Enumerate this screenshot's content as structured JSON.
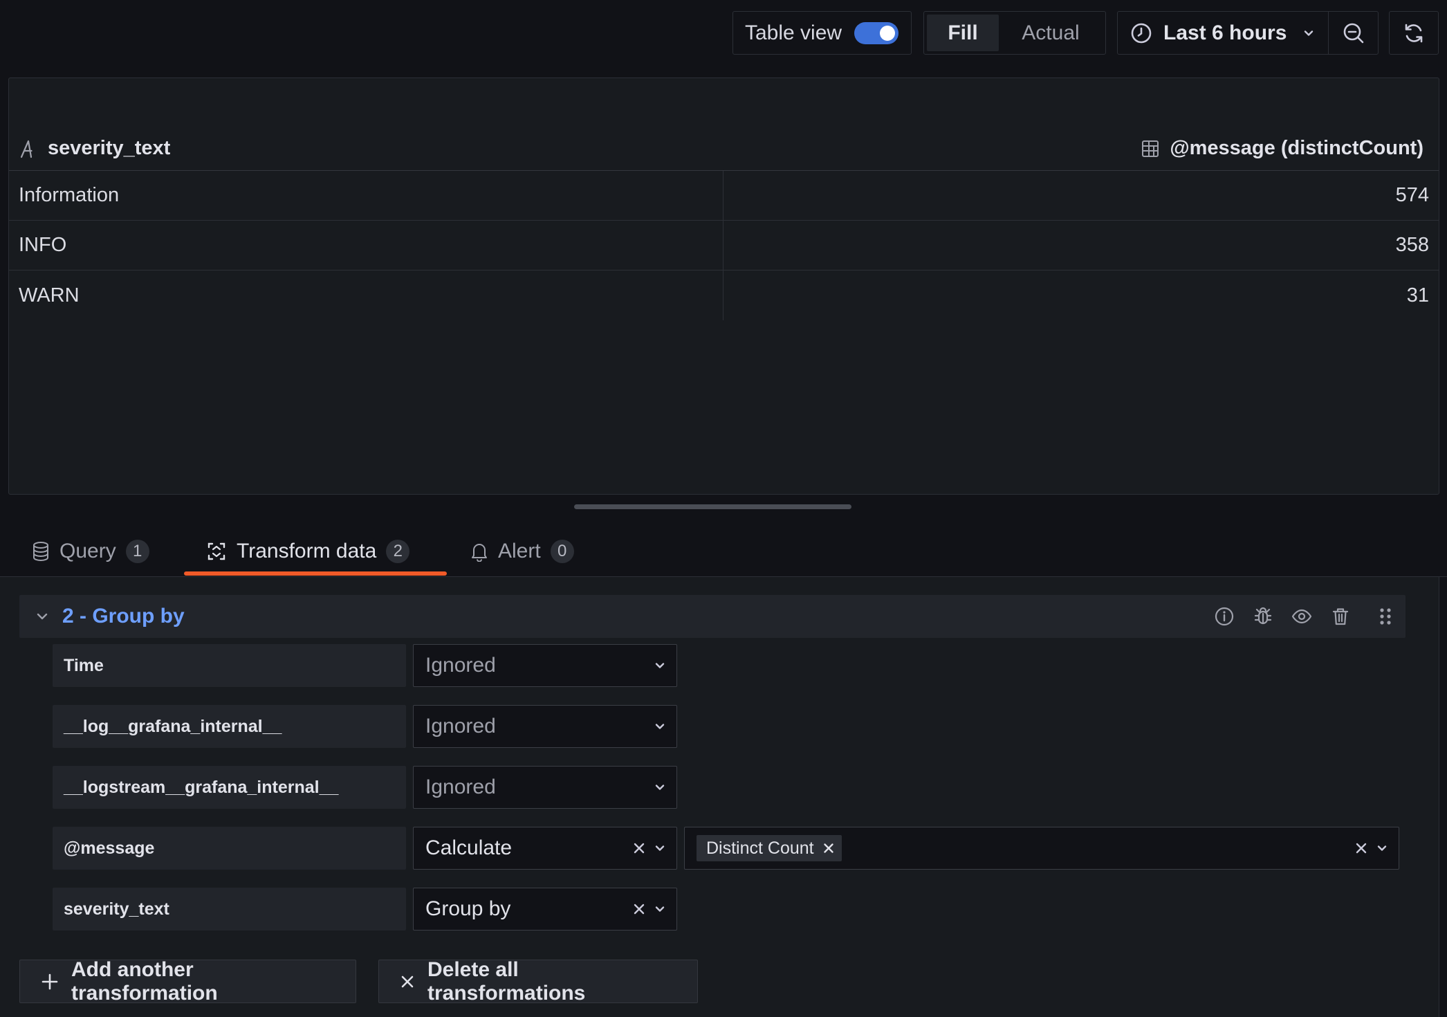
{
  "toolbar": {
    "table_view_label": "Table view",
    "table_view_on": true,
    "fill_label": "Fill",
    "actual_label": "Actual",
    "time_range_label": "Last 6 hours",
    "accent_color": "#3d71d9"
  },
  "table": {
    "columns": [
      {
        "label": "severity_text",
        "icon": "text-type-icon"
      },
      {
        "label": "@message (distinctCount)",
        "icon": "table-grid-icon"
      }
    ],
    "rows": [
      {
        "severity_text": "Information",
        "count": "574"
      },
      {
        "severity_text": "INFO",
        "count": "358"
      },
      {
        "severity_text": "WARN",
        "count": "31"
      }
    ]
  },
  "tabs": [
    {
      "label": "Query",
      "count": "1",
      "icon": "database-icon"
    },
    {
      "label": "Transform data",
      "count": "2",
      "icon": "transform-icon",
      "active": true
    },
    {
      "label": "Alert",
      "count": "0",
      "icon": "bell-icon"
    }
  ],
  "transformation": {
    "title": "2 - Group by",
    "fields": [
      {
        "name": "Time",
        "option": "Ignored"
      },
      {
        "name": "__log__grafana_internal__",
        "option": "Ignored"
      },
      {
        "name": "__logstream__grafana_internal__",
        "option": "Ignored"
      },
      {
        "name": "@message",
        "option": "Calculate",
        "calculations": [
          "Distinct Count"
        ]
      },
      {
        "name": "severity_text",
        "option": "Group by"
      }
    ]
  },
  "buttons": {
    "add_label": "Add another transformation",
    "delete_label": "Delete all transformations"
  },
  "colors": {
    "active_tab_underline": "#f05a28",
    "title_link": "#6e9fff"
  }
}
